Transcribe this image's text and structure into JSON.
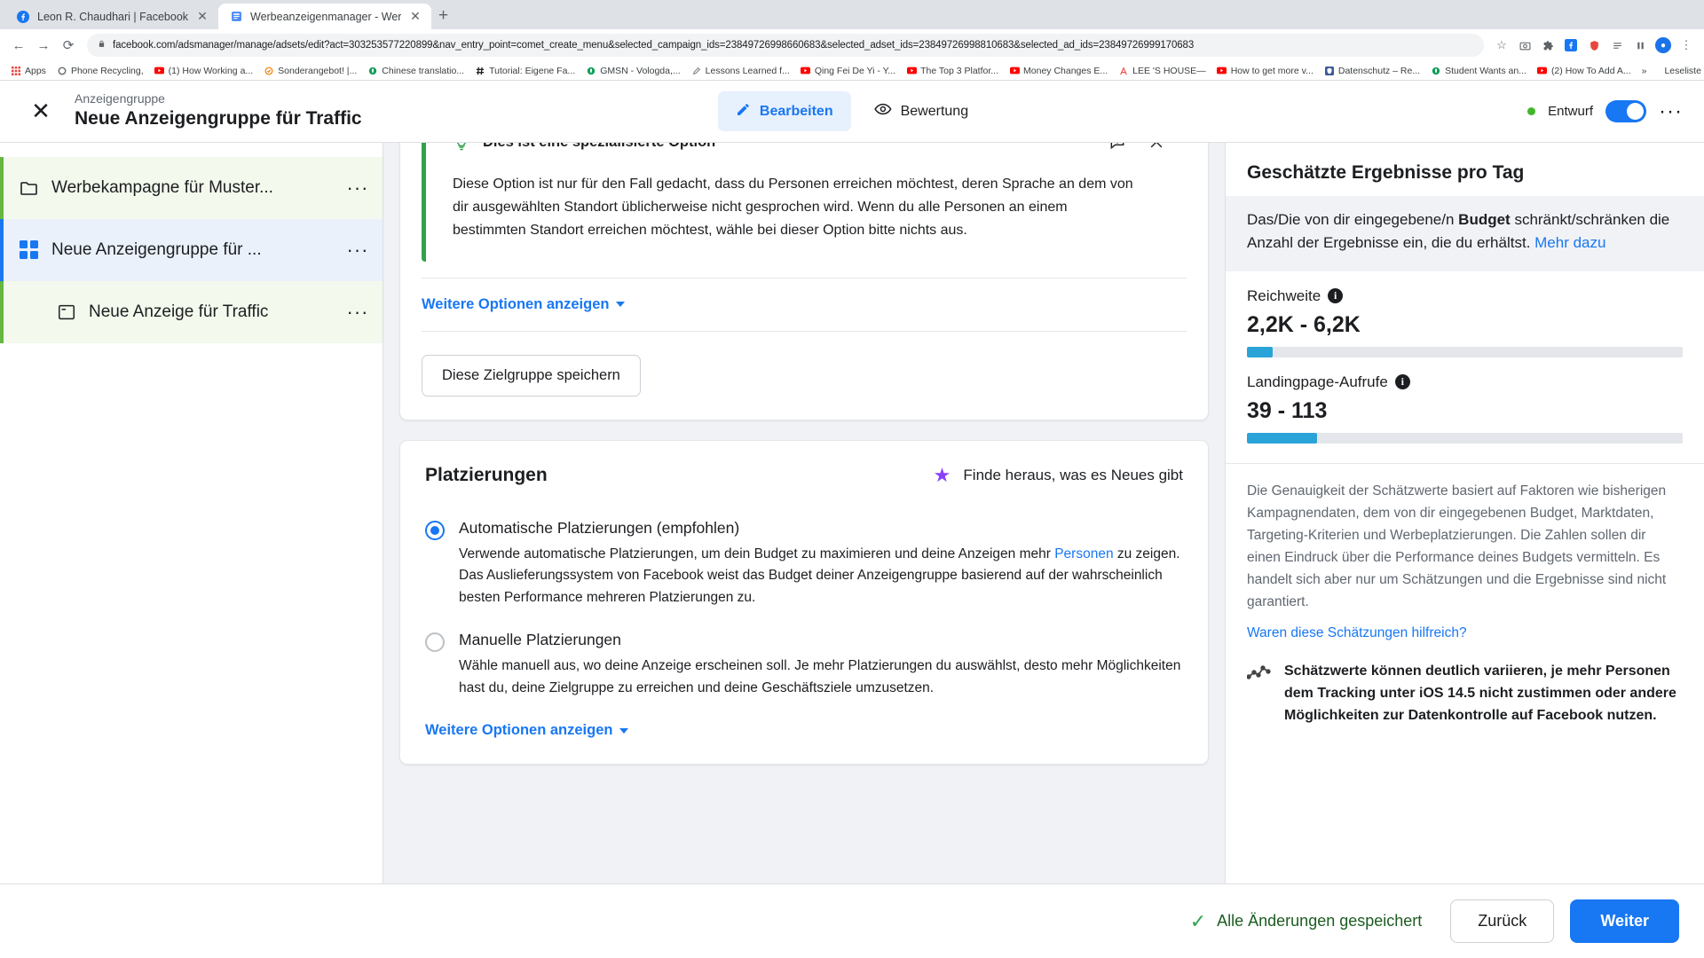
{
  "browser": {
    "tabs": [
      {
        "title": "Leon R. Chaudhari | Facebook",
        "favicon": "facebook-icon",
        "active": false
      },
      {
        "title": "Werbeanzeigenmanager - Wer",
        "favicon": "adsmanager-icon",
        "active": true
      }
    ],
    "new_tab_label": "+",
    "url": "facebook.com/adsmanager/manage/adsets/edit?act=303253577220899&nav_entry_point=comet_create_menu&selected_campaign_ids=23849726998660683&selected_adset_ids=23849726998810683&selected_ad_ids=23849726999170683",
    "back_icon": "back-arrow-icon",
    "forward_icon": "forward-arrow-icon",
    "reload_icon": "reload-icon",
    "lock_icon": "lock-icon",
    "toolbar_icons": [
      "star-icon",
      "camera-icon",
      "puzzle-icon",
      "facebook-icon",
      "shield-icon",
      "list-icon",
      "pause-icon",
      "account-icon",
      "menu-icon"
    ],
    "bookmarks": [
      {
        "label": "Apps",
        "icon": "apps-grid-icon",
        "color": "#e8453c"
      },
      {
        "label": "Phone Recycling,",
        "icon": "circle-icon",
        "color": "#5f6368"
      },
      {
        "label": "(1) How Working a...",
        "icon": "youtube-icon",
        "color": "#ff0000"
      },
      {
        "label": "Sonderangebot! |...",
        "icon": "badge-icon",
        "color": "#f57c00"
      },
      {
        "label": "Chinese translatio...",
        "icon": "leaf-icon",
        "color": "#0f9d58"
      },
      {
        "label": "Tutorial: Eigene Fa...",
        "icon": "hash-icon",
        "color": "#222222"
      },
      {
        "label": "GMSN - Vologda,...",
        "icon": "leaf-icon",
        "color": "#0f9d58"
      },
      {
        "label": "Lessons Learned f...",
        "icon": "pen-icon",
        "color": "#8a8a8a"
      },
      {
        "label": "Qing Fei De Yi - Y...",
        "icon": "youtube-icon",
        "color": "#ff0000"
      },
      {
        "label": "The Top 3 Platfor...",
        "icon": "youtube-icon",
        "color": "#ff0000"
      },
      {
        "label": "Money Changes E...",
        "icon": "youtube-icon",
        "color": "#ff0000"
      },
      {
        "label": "LEE 'S HOUSE—",
        "icon": "a-icon",
        "color": "#e8453c"
      },
      {
        "label": "How to get more v...",
        "icon": "youtube-icon",
        "color": "#ff0000"
      },
      {
        "label": "Datenschutz – Re...",
        "icon": "shield-icon",
        "color": "#3b5998"
      },
      {
        "label": "Student Wants an...",
        "icon": "leaf-icon",
        "color": "#0f9d58"
      },
      {
        "label": "(2) How To Add A...",
        "icon": "youtube-icon",
        "color": "#ff0000"
      }
    ],
    "overflow_label": "»",
    "reading_list_label": "Leseliste"
  },
  "header": {
    "close_icon": "close-icon",
    "eyebrow": "Anzeigengruppe",
    "title": "Neue Anzeigengruppe für Traffic",
    "tabs": [
      {
        "label": "Bearbeiten",
        "icon": "pencil-icon",
        "active": true
      },
      {
        "label": "Bewertung",
        "icon": "eye-icon",
        "active": false
      }
    ],
    "status": "Entwurf",
    "status_color": "#42b72a",
    "toggle_on": true,
    "more_icon": "more-horizontal-icon"
  },
  "sidebar": {
    "items": [
      {
        "label": "Werbekampagne für Muster...",
        "icon": "folder-icon",
        "highlight": "green",
        "indent": 0
      },
      {
        "label": "Neue Anzeigengruppe für ...",
        "icon": "adset-grid-icon",
        "highlight": "blue",
        "indent": 0
      },
      {
        "label": "Neue Anzeige für Traffic",
        "icon": "ad-window-icon",
        "highlight": "green",
        "indent": 1
      }
    ],
    "menu_icon": "more-horizontal-icon"
  },
  "main": {
    "notice": {
      "icon": "lightbulb-icon",
      "title": "Dies ist eine spezialisierte Option",
      "body": "Diese Option ist nur für den Fall gedacht, dass du Personen erreichen möchtest, deren Sprache an dem von dir ausgewählten Standort üblicherweise nicht gesprochen wird. Wenn du alle Personen an einem bestimmten Standort erreichen möchtest, wähle bei dieser Option bitte nichts aus.",
      "feedback_icon": "feedback-icon",
      "close_icon": "close-icon"
    },
    "show_more_options_1": "Weitere Optionen anzeigen",
    "save_audience_button": "Diese Zielgruppe speichern",
    "placements": {
      "title": "Platzierungen",
      "whats_new": "Finde heraus, was es Neues gibt",
      "whats_new_icon": "star-icon",
      "options": [
        {
          "label": "Automatische Platzierungen (empfohlen)",
          "selected": true,
          "desc_part1": "Verwende automatische Platzierungen, um dein Budget zu maximieren und deine Anzeigen mehr ",
          "desc_link": "Personen",
          "desc_part2": " zu zeigen. Das Auslieferungssystem von Facebook weist das Budget deiner Anzeigengruppe basierend auf der wahrscheinlich besten Performance mehreren Platzierungen zu."
        },
        {
          "label": "Manuelle Platzierungen",
          "selected": false,
          "desc_part1": "Wähle manuell aus, wo deine Anzeige erscheinen soll. Je mehr Platzierungen du auswählst, desto mehr Möglichkeiten hast du, deine Zielgruppe zu erreichen und deine Geschäftsziele umzusetzen.",
          "desc_link": "",
          "desc_part2": ""
        }
      ],
      "show_more_options": "Weitere Optionen anzeigen"
    }
  },
  "right_panel": {
    "title": "Geschätzte Ergebnisse pro Tag",
    "note_part1": "Das/Die von dir eingegebene/n ",
    "note_bold": "Budget",
    "note_part2": " schränkt/schränken die Anzahl der Ergebnisse ein, die du erhältst. ",
    "note_link": "Mehr dazu",
    "metrics": [
      {
        "label": "Reichweite",
        "value": "2,2K - 6,2K",
        "fill_percent": 6,
        "info_icon": "info-icon"
      },
      {
        "label": "Landingpage-Aufrufe",
        "value": "39 - 113",
        "fill_percent": 16,
        "info_icon": "info-icon"
      }
    ],
    "bar_color": "#2aa3d8",
    "disclaimer": "Die Genauigkeit der Schätzwerte basiert auf Faktoren wie bisherigen Kampagnendaten, dem von dir eingegebenen Budget, Marktdaten, Targeting-Kriterien und Werbeplatzierungen. Die Zahlen sollen dir einen Eindruck über die Performance deines Budgets vermitteln. Es handelt sich aber nur um Schätzungen und die Ergebnisse sind nicht garantiert.",
    "helpful_link": "Waren diese Schätzungen hilfreich?",
    "warning_icon": "chart-trend-icon",
    "warning_text": "Schätzwerte können deutlich variieren, je mehr Personen dem Tracking unter iOS 14.5 nicht zustimmen oder andere Möglichkeiten zur Datenkontrolle auf Facebook nutzen."
  },
  "footer": {
    "saved_text": "Alle Änderungen gespeichert",
    "saved_icon": "check-icon",
    "back_button": "Zurück",
    "next_button": "Weiter"
  }
}
